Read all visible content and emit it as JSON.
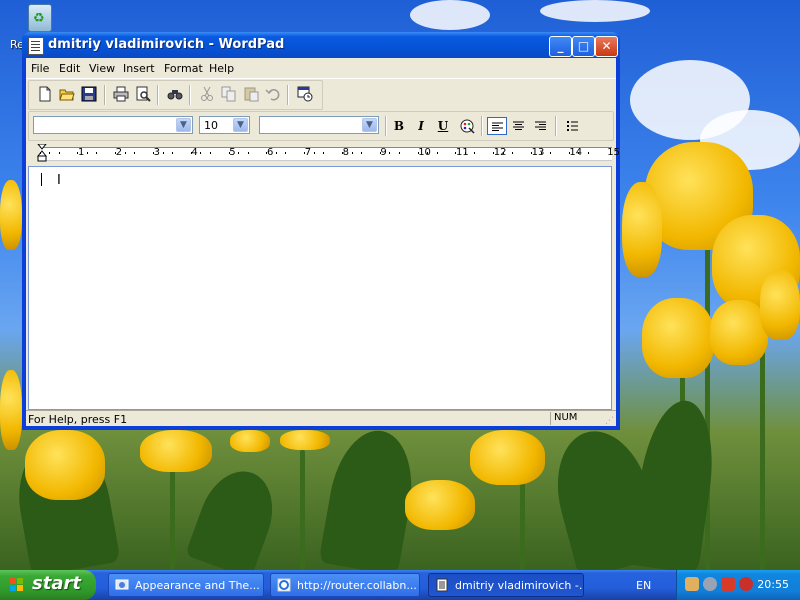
{
  "desktop": {
    "recycle_bin_label": "Re"
  },
  "window": {
    "title": "dmitriy vladimirovich - WordPad",
    "controls": {
      "minimize": "_",
      "maximize": "□",
      "close": "✕"
    }
  },
  "menu": {
    "items": [
      "File",
      "Edit",
      "View",
      "Insert",
      "Format",
      "Help"
    ]
  },
  "toolbar": {
    "icons": [
      "new-icon",
      "open-icon",
      "save-icon",
      "print-icon",
      "print-preview-icon",
      "find-icon",
      "cut-icon",
      "copy-icon",
      "paste-icon",
      "undo-icon",
      "datetime-icon"
    ]
  },
  "format_bar": {
    "font_name": "",
    "font_size": "10",
    "script": "",
    "bold": "B",
    "italic": "I",
    "underline": "U"
  },
  "ruler": {
    "marks": [
      "1",
      "2",
      "3",
      "4",
      "5",
      "6",
      "7",
      "8",
      "9",
      "10",
      "11",
      "12",
      "13",
      "14",
      "15"
    ]
  },
  "document": {
    "text": ""
  },
  "status": {
    "help_text": "For Help, press F1",
    "num_lock": "NUM"
  },
  "taskbar": {
    "start_label": "start",
    "tasks": [
      {
        "label": "Appearance and The...",
        "active": false
      },
      {
        "label": "http://router.collabn...",
        "active": false
      },
      {
        "label": "dmitriy vladimirovich -...",
        "active": true
      }
    ],
    "language": "EN",
    "clock": "20:55"
  },
  "colors": {
    "titlebar": "#0553d6",
    "window_face": "#ece9d8",
    "taskbar": "#245edb",
    "start_button": "#3aa935"
  }
}
